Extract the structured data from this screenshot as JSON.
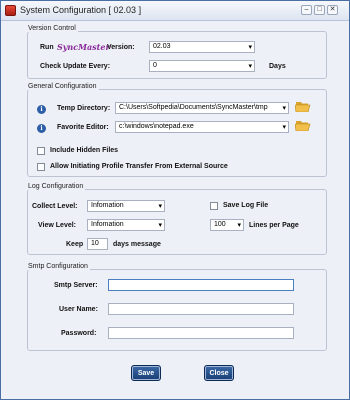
{
  "window": {
    "title": "System Configuration [ 02.03 ]"
  },
  "version_control": {
    "group_title": "Version Control",
    "run_label": "Run",
    "logo_text": "SyncMaster",
    "version_label": "Version:",
    "version_value": "02.03",
    "check_update_label": "Check Update Every:",
    "check_update_value": "0",
    "days_label": "Days"
  },
  "general_configuration": {
    "group_title": "General Configuration",
    "temp_directory_label": "Temp Directory:",
    "temp_directory_value": "C:\\Users\\Softpedia\\Documents\\SyncMaster\\tmp",
    "favorite_editor_label": "Favorite Editor:",
    "favorite_editor_value": "c:\\windows\\notepad.exe",
    "include_hidden_label": "Include Hidden Files",
    "allow_transfer_label": "Allow Initiating Profile Transfer From External Source"
  },
  "log_configuration": {
    "group_title": "Log Configuration",
    "collect_level_label": "Collect Level:",
    "collect_level_value": "Infomation",
    "view_level_label": "View Level:",
    "view_level_value": "Infomation",
    "keep_label": "Keep",
    "keep_value": "10",
    "days_message_label": "days message",
    "save_log_label": "Save Log File",
    "lines_value": "100",
    "lines_per_page_label": "Lines per Page"
  },
  "smtp_configuration": {
    "group_title": "Smtp Configuration",
    "server_label": "Smtp Server:",
    "server_value": "",
    "user_label": "User Name:",
    "user_value": "",
    "password_label": "Password:",
    "password_value": ""
  },
  "buttons": {
    "save": "Save",
    "close": "Close"
  },
  "icons": {
    "info": "info-icon",
    "folder": "folder-open-icon"
  },
  "colors": {
    "button": "#2a558f",
    "info": "#2d5ea8",
    "folder": "#e6b43c"
  }
}
